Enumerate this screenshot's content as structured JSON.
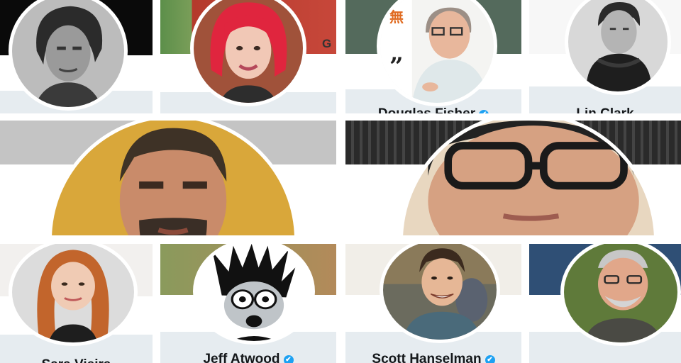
{
  "profiles": [
    {
      "id": "top-1",
      "name": "",
      "verified": false
    },
    {
      "id": "top-2",
      "name": "",
      "verified": false
    },
    {
      "id": "top-3",
      "name": "Douglas Fisher",
      "verified": true
    },
    {
      "id": "top-4",
      "name": "Lin Clark",
      "verified": false
    },
    {
      "id": "mid-1",
      "name": "",
      "verified": false
    },
    {
      "id": "mid-2",
      "name": "",
      "verified": false
    },
    {
      "id": "bot-1",
      "name": "Sara Vieira",
      "verified": false
    },
    {
      "id": "bot-2",
      "name": "Jeff Atwood",
      "verified": true
    },
    {
      "id": "bot-3",
      "name": "Scott Hanselman",
      "verified": true
    },
    {
      "id": "bot-4",
      "name": "",
      "verified": false
    }
  ],
  "banner_text": {
    "g_letter": "G",
    "kanji": "無",
    "quote": "”"
  },
  "verified_glyph": "✔",
  "icons": {
    "verified": "verified-badge-icon"
  },
  "colors": {
    "footer": "#e6ecf0",
    "verified": "#1da1f2",
    "name": "#14171a"
  }
}
